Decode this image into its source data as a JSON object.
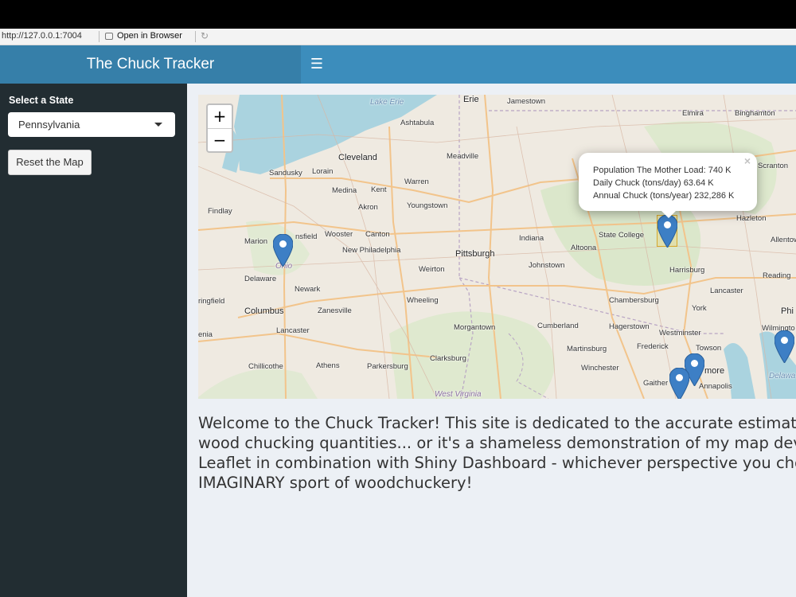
{
  "browser": {
    "url": "http://127.0.0.1:7004",
    "open_in_browser_label": "Open in Browser"
  },
  "header": {
    "title": "The Chuck Tracker",
    "toggle_icon": "hamburger-icon"
  },
  "sidebar": {
    "state_label": "Select a State",
    "state_selected": "Pennsylvania",
    "reset_button": "Reset the Map"
  },
  "map": {
    "zoom_in": "+",
    "zoom_out": "−",
    "places": {
      "lake_erie": "Lake Erie",
      "erie": "Erie",
      "jamestown": "Jamestown",
      "elmira": "Elmira",
      "binghamton": "Binghamton",
      "ashtabula": "Ashtabula",
      "cleveland": "Cleveland",
      "meadville": "Meadville",
      "sandusky": "Sandusky",
      "lorain": "Lorain",
      "warren": "Warren",
      "scranton": "Scranton",
      "medina": "Medina",
      "kent": "Kent",
      "akron": "Akron",
      "youngstown": "Youngstown",
      "findlay": "Findlay",
      "hazleton": "Hazleton",
      "mansfield": "nsfield",
      "wooster": "Wooster",
      "canton": "Canton",
      "indiana": "Indiana",
      "state_college": "State College",
      "allentown": "Allentow",
      "marion": "Marion",
      "new_philadelphia": "New Philadelphia",
      "pittsburgh": "Pittsburgh",
      "altoona": "Altoona",
      "ohio": "Ohio",
      "johnstown": "Johnstown",
      "delaware": "Delaware",
      "weirton": "Weirton",
      "harrisburg": "Harrisburg",
      "reading": "Reading",
      "newark": "Newark",
      "lancaster_pa": "Lancaster",
      "springfield": "ringfield",
      "wheeling": "Wheeling",
      "chambersburg": "Chambersburg",
      "columbus": "Columbus",
      "zanesville": "Zanesville",
      "york": "York",
      "phila": "Phi",
      "lancaster_oh": "Lancaster",
      "morgantown": "Morgantown",
      "cumberland": "Cumberland",
      "hagerstown": "Hagerstown",
      "westminster": "Westminster",
      "wilmington": "Wilmingto",
      "xenia": "enia",
      "martinsburg": "Martinsburg",
      "frederick": "Frederick",
      "towson": "Towson",
      "chillicothe": "Chillicothe",
      "athens": "Athens",
      "parkersburg": "Parkersburg",
      "clarksburg": "Clarksburg",
      "winchester": "Winchester",
      "baltimore": "more",
      "delaware_state": "Delawa",
      "gaithersburg": "Gaither",
      "annapolis": "Annapolis",
      "west_virginia": "West Virginia"
    },
    "popup": {
      "line1": "Population The Mother Load: 740 K",
      "line2": "Daily Chuck (tons/day) 63.64 K",
      "line3": "Annual Chuck (tons/year) 232,286 K",
      "close": "×"
    },
    "marker_icon": "map-pin-icon"
  },
  "welcome": {
    "line1": "Welcome to the Chuck Tracker! This site is dedicated to the accurate estimation",
    "line2": "wood chucking quantities... or it's a shameless demonstration of my map devel",
    "line3": "Leaflet in combination with Shiny Dashboard - whichever perspective you choo",
    "line4": "IMAGINARY sport of woodchuckery!"
  },
  "colors": {
    "header_bg": "#3c8dbc",
    "logo_bg": "#367fa9",
    "sidebar_bg": "#222d32",
    "content_bg": "#ecf0f5",
    "marker": "#3d7fc5",
    "water": "#aad3df"
  }
}
